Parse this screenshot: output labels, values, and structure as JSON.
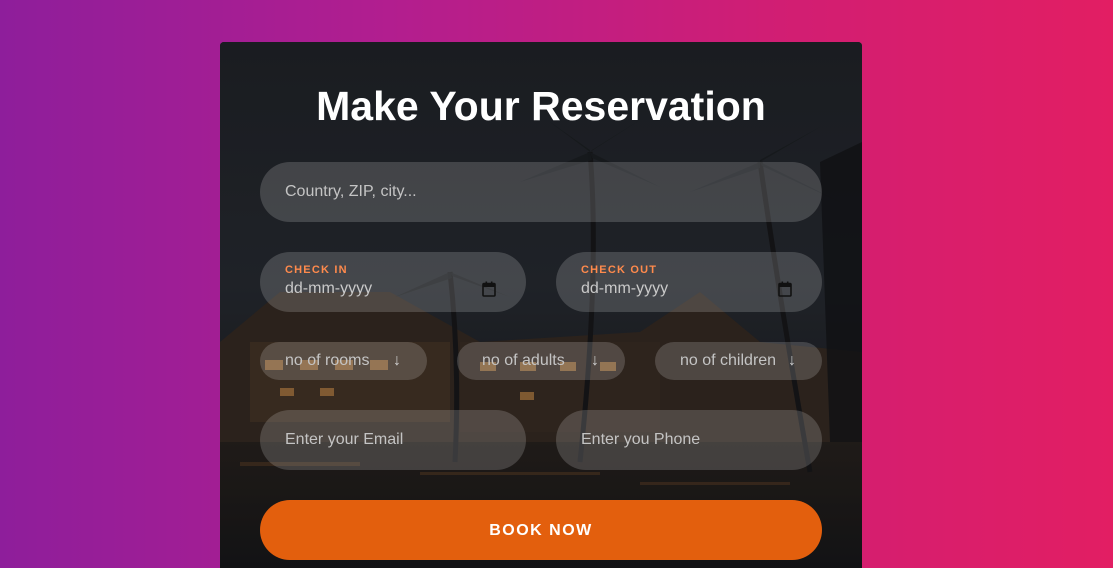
{
  "form": {
    "title": "Make Your Reservation",
    "location_placeholder": "Country, ZIP, city...",
    "check_in_label": "CHECK IN",
    "check_in_value": "dd-mm-yyyy",
    "check_out_label": "CHECK OUT",
    "check_out_value": "dd-mm-yyyy",
    "rooms_label": "no of rooms",
    "adults_label": "no of adults",
    "children_label": "no of children",
    "select_arrow": "↓",
    "email_placeholder": "Enter your Email",
    "phone_placeholder": "Enter you Phone",
    "book_label": "BOOK NOW"
  },
  "icons": {
    "calendar": "calendar-icon",
    "arrow": "arrow-down-icon"
  },
  "colors": {
    "background_gradient_start": "#8e1e9b",
    "background_gradient_end": "#e21e63",
    "accent_label": "#ff8a4c",
    "book_button": "#e35f0d"
  }
}
